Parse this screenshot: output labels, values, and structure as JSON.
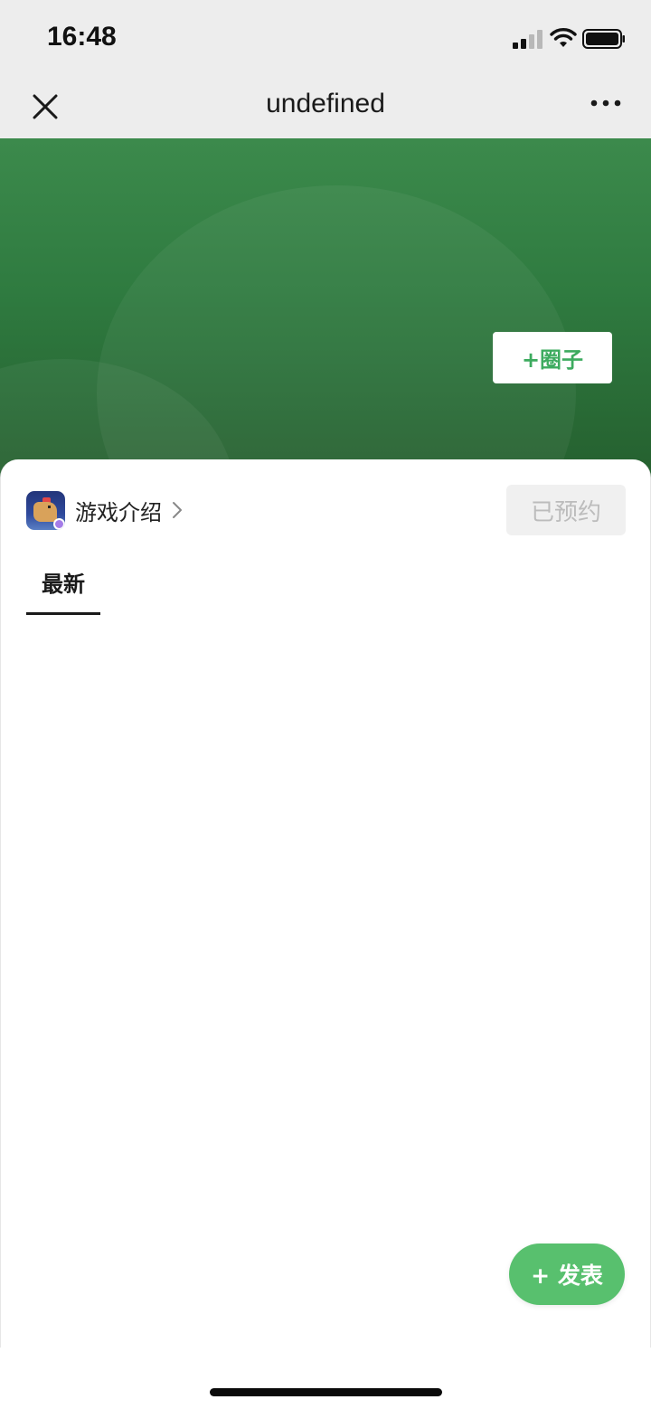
{
  "status_bar": {
    "time": "16:48",
    "icons": [
      "signal-icon",
      "wifi-icon",
      "battery-icon"
    ]
  },
  "nav": {
    "title": "undefined",
    "close_icon": "close-icon",
    "more_icon": "more-icon"
  },
  "banner": {
    "join_label": "+圈子",
    "color": "#2f7b40"
  },
  "game": {
    "intro_label": "游戏介绍",
    "reserved_label": "已预约"
  },
  "tabs": [
    {
      "label": "最新",
      "active": true
    }
  ],
  "publish_label": "+ 发表",
  "colors": {
    "accent_green": "#58c06e",
    "join_text": "#3dab5f",
    "nav_background": "#ededed"
  }
}
